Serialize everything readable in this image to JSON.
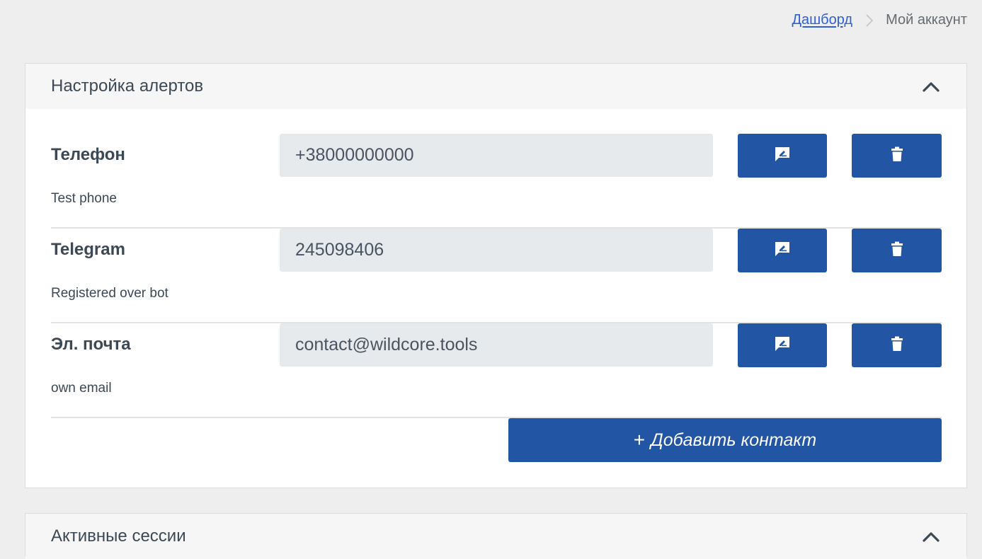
{
  "breadcrumb": {
    "home": "Дашборд",
    "current": "Мой аккаунт"
  },
  "alerts": {
    "title": "Настройка алертов",
    "contacts": [
      {
        "name": "Телефон",
        "description": "Test phone",
        "value": "+38000000000"
      },
      {
        "name": "Telegram",
        "description": "Registered over bot",
        "value": "245098406"
      },
      {
        "name": "Эл. почта",
        "description": "own email",
        "value": "contact@wildcore.tools"
      }
    ],
    "add_label": "Добавить контакт",
    "add_icon": "+"
  },
  "sessions": {
    "title": "Активные сессии"
  },
  "colors": {
    "primary": "#2355a5",
    "link": "#2f5fd6",
    "background": "#eeeeee"
  },
  "icons": {
    "edit": "edit-message-icon",
    "delete": "trash-icon",
    "collapse": "chevron-up-icon",
    "separator": "chevron-right-icon"
  }
}
